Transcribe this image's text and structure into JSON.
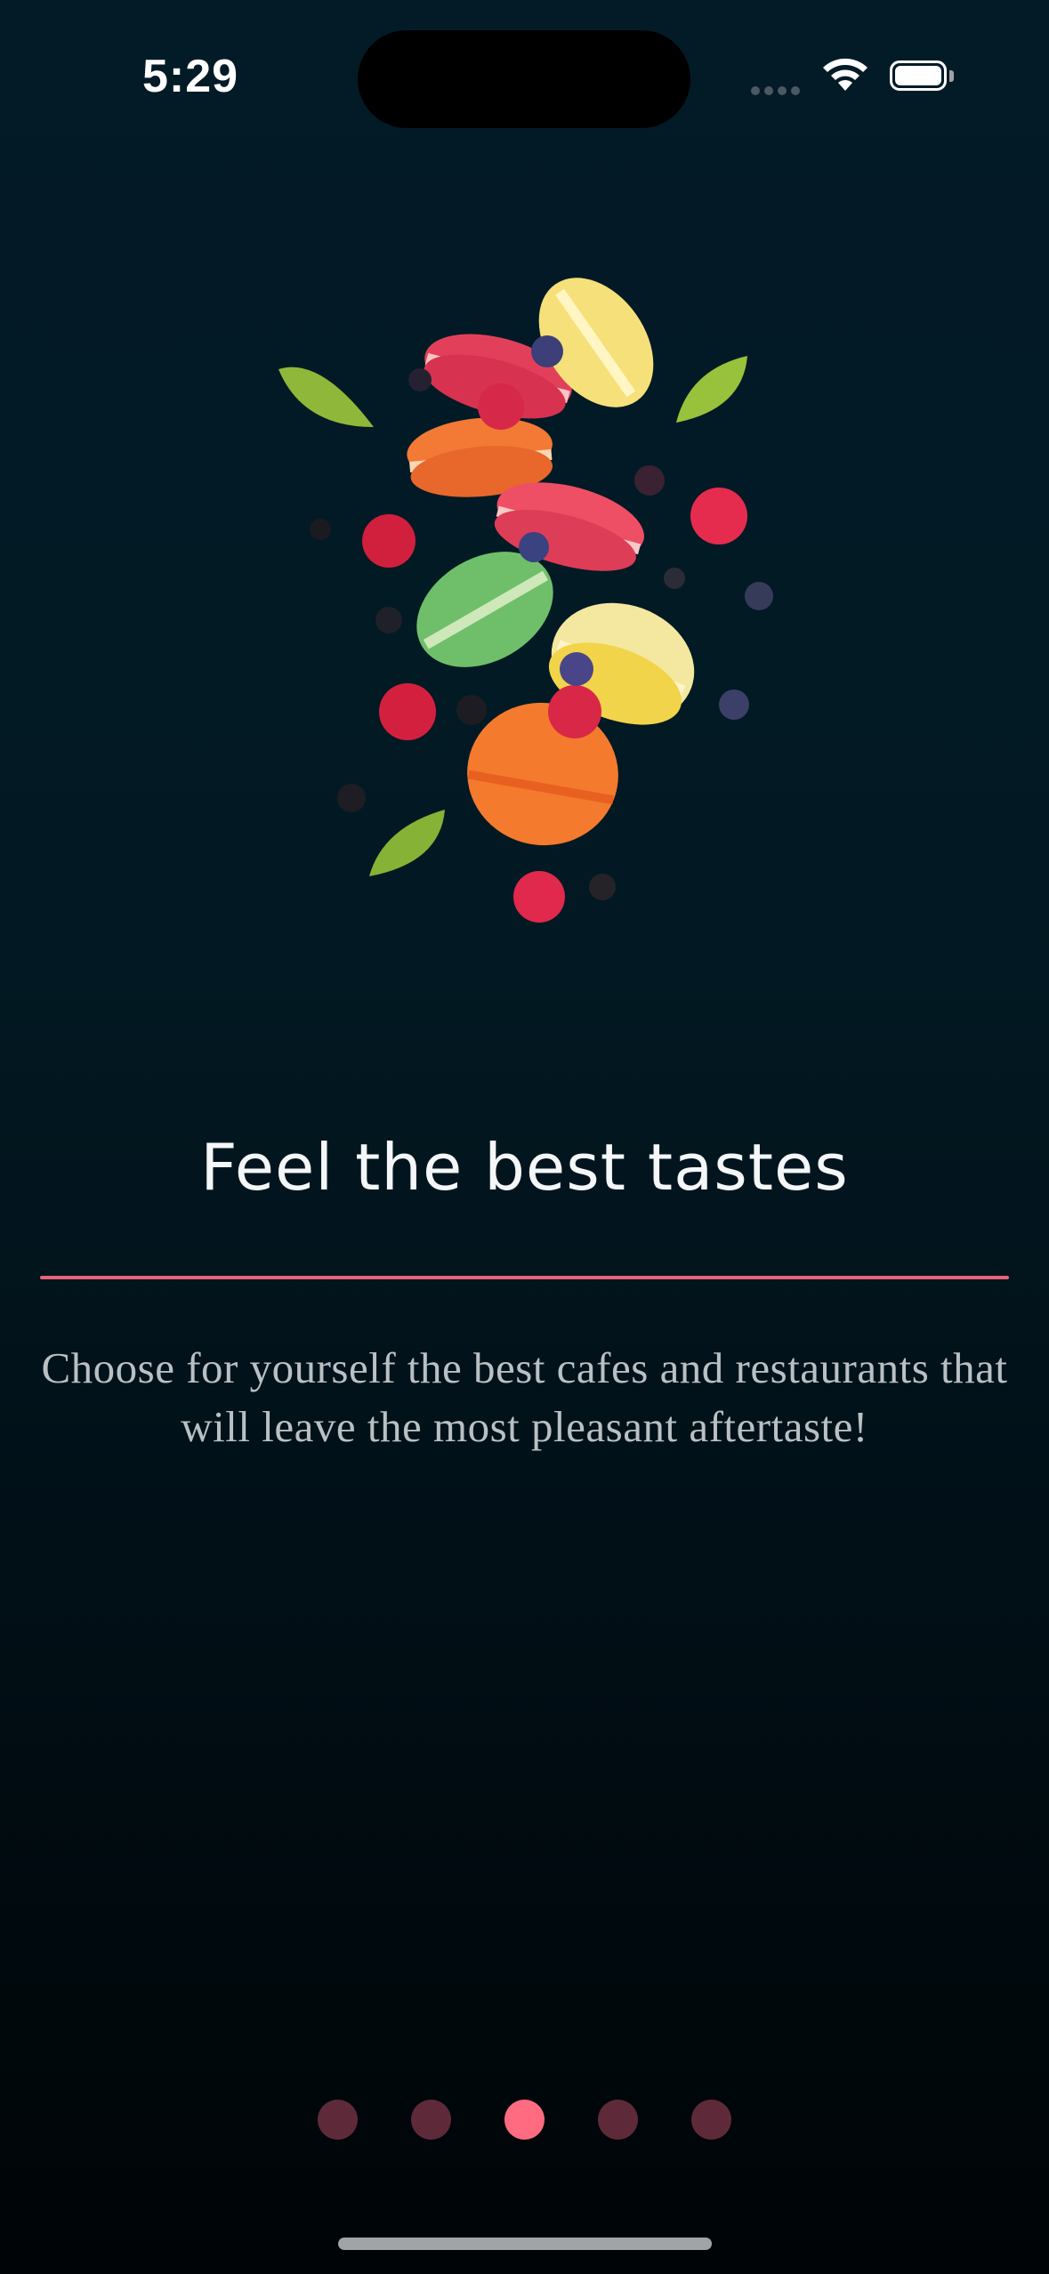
{
  "status_bar": {
    "time": "5:29",
    "icons": [
      "cellular-signal-icon",
      "wifi-icon",
      "battery-icon"
    ]
  },
  "hero_image": {
    "description_icon": "macarons-berries-illustration"
  },
  "onboarding": {
    "title": "Feel the best tastes",
    "subtitle": "Choose for yourself the best cafes and restaurants that will leave the most pleasant aftertaste!",
    "page_count": 5,
    "active_page": 3
  },
  "colors": {
    "accent": "#ff6b80",
    "divider": "#e86479",
    "dot_inactive": "#5e2a39",
    "background_top": "#031b27",
    "background_bottom": "#000406"
  }
}
